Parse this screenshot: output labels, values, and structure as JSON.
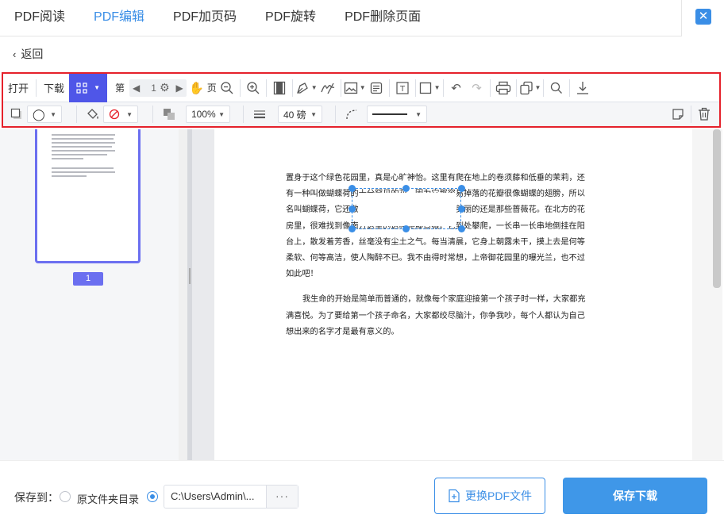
{
  "tabs": [
    {
      "label": "PDF阅读"
    },
    {
      "label": "PDF编辑",
      "active": true
    },
    {
      "label": "PDF加页码"
    },
    {
      "label": "PDF旋转"
    },
    {
      "label": "PDF删除页面"
    }
  ],
  "back_label": "返回",
  "toolbar": {
    "open_label": "打开",
    "download_label": "下载",
    "page_prefix": "第",
    "page_current": "1",
    "page_suffix": "页",
    "opacity_value": "100%",
    "stroke_width_value": "40 磅"
  },
  "thumbnail": {
    "page_label": "1"
  },
  "document": {
    "paragraph1": "置身于这个绿色花园里，真是心旷神怡。这里有爬在地上的卷须藤和低垂的茉莉，还有一种叫做蝴蝶荷的十分罕见的花。因为它那容易掉落的花瓣很像蝴蝶的翅膀，所以名叫蝴蝶荷，它还散发着一种好闻的气味。但最美丽的还是那些蔷薇花。在北方的花房里，很难找到像南方这里的这种爬藤蔷薇。它到处攀爬，一长串一长串地倒挂在阳台上，散发着芳香，丝毫没有尘土之气。每当清晨，它身上朝露未干，摸上去是何等柔软、何等高洁，使人陶醉不已。我不由得时常想，上帝御花园里的曝光兰，也不过如此吧！",
    "paragraph2": "我生命的开始是简单而普通的，就像每个家庭迎接第一个孩子时一样，大家都充满喜悦。为了要给第一个孩子命名，大家都绞尽脑汁，你争我吵，每个人都认为自己想出来的名字才是最有意义的。"
  },
  "bottom": {
    "save_to_label": "保存到：",
    "option_source_label": "原文件夹目录",
    "path_value": "C:\\Users\\Admin\\...",
    "more_label": "···",
    "replace_button_label": "更换PDF文件",
    "save_button_label": "保存下载"
  },
  "colors": {
    "accent": "#3a8ee6",
    "toolbar_active": "#4f56e8",
    "highlight_border": "#e5212b"
  }
}
